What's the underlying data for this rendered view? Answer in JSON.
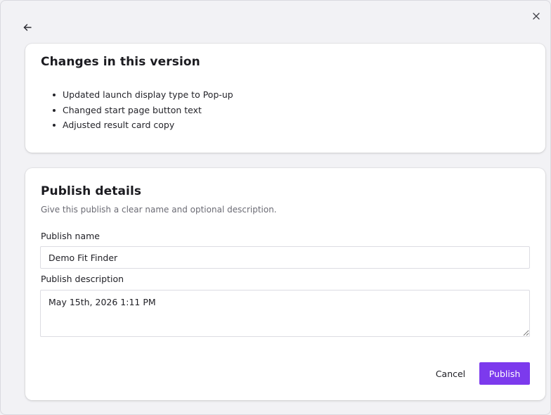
{
  "colors": {
    "accent": "#7c3aed",
    "background": "#f2f2f5",
    "card": "#ffffff"
  },
  "icons": {
    "back": "arrow-left-icon",
    "close": "close-icon"
  },
  "changes": {
    "title": "Changes in this version",
    "items": [
      "Updated launch display type to Pop-up",
      "Changed start page button text",
      "Adjusted result card copy"
    ]
  },
  "publish": {
    "title": "Publish details",
    "subtitle": "Give this publish a clear name and optional description.",
    "name_label": "Publish name",
    "name_value": "Demo Fit Finder",
    "description_label": "Publish description",
    "description_value": "May 15th, 2026 1:11 PM",
    "cancel_label": "Cancel",
    "publish_label": "Publish"
  }
}
